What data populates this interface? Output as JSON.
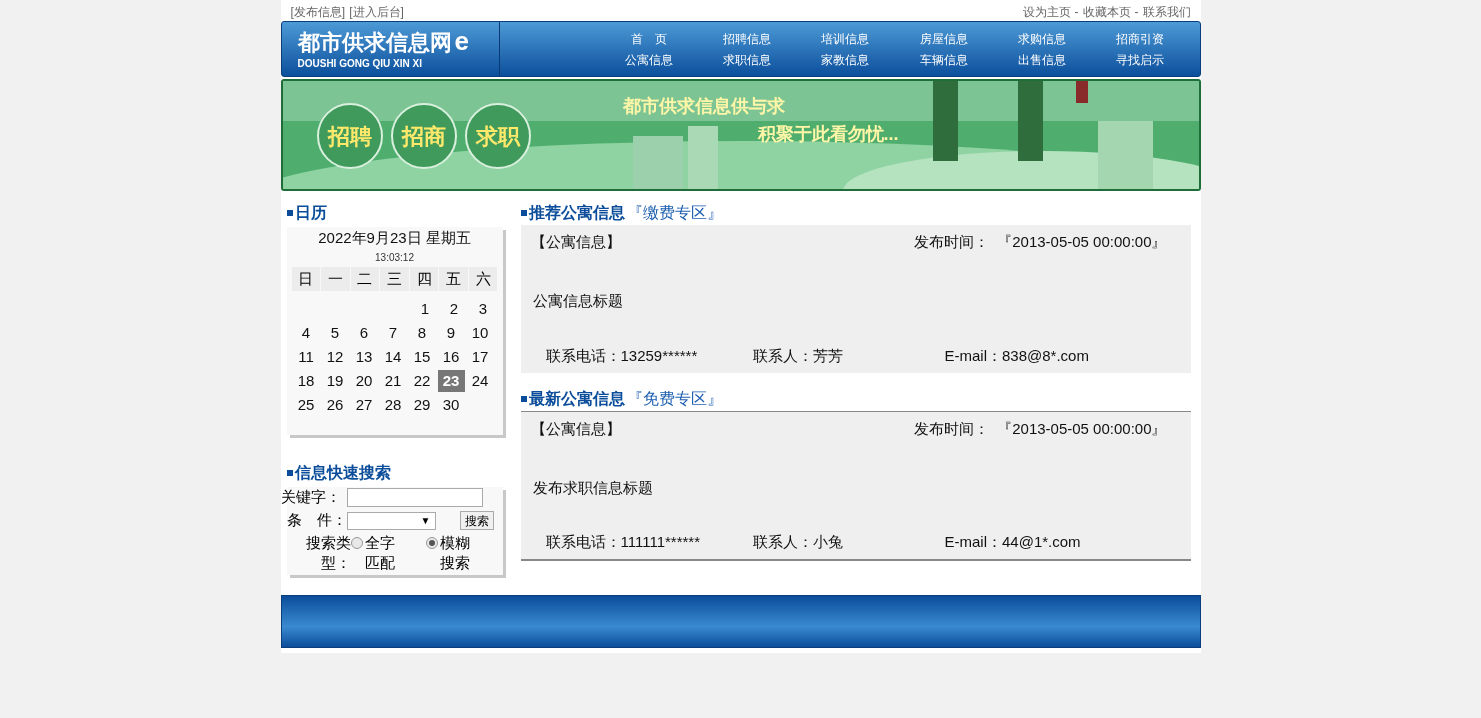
{
  "top_links_left": [
    "[发布信息]",
    "[进入后台]"
  ],
  "top_links_right": [
    "设为主页",
    "-",
    "收藏本页",
    "-",
    "联系我们"
  ],
  "logo": {
    "title": "都市供求信息网",
    "mark": "e",
    "subtitle": "DOUSHI GONG QIU XIN XI"
  },
  "nav": [
    [
      "首　页",
      "公寓信息"
    ],
    [
      "招聘信息",
      "求职信息"
    ],
    [
      "培训信息",
      "家教信息"
    ],
    [
      "房屋信息",
      "车辆信息"
    ],
    [
      "求购信息",
      "出售信息"
    ],
    [
      "招商引资",
      "寻找启示"
    ]
  ],
  "banner": {
    "buttons": [
      "招聘",
      "招商",
      "求职"
    ],
    "slogan_1": "都市供求信息供与求",
    "slogan_2": "积聚于此看勿忧..."
  },
  "calendar": {
    "heading": "日历",
    "date": "2022年9月23日 星期五",
    "time": "13:03:12",
    "weekdays": [
      "日",
      "一",
      "二",
      "三",
      "四",
      "五",
      "六"
    ],
    "weeks": [
      [
        {
          "day": "1",
          "selected": false
        },
        {
          "day": "2",
          "selected": false
        },
        {
          "day": "3",
          "selected": false
        }
      ],
      [
        {
          "day": "4",
          "selected": false
        },
        {
          "day": "5",
          "selected": false
        },
        {
          "day": "6",
          "selected": false
        },
        {
          "day": "7",
          "selected": false
        },
        {
          "day": "8",
          "selected": false
        },
        {
          "day": "9",
          "selected": false
        },
        {
          "day": "10",
          "selected": false
        }
      ],
      [
        {
          "day": "11",
          "selected": false
        },
        {
          "day": "12",
          "selected": false
        },
        {
          "day": "13",
          "selected": false
        },
        {
          "day": "14",
          "selected": false
        },
        {
          "day": "15",
          "selected": false
        },
        {
          "day": "16",
          "selected": false
        },
        {
          "day": "17",
          "selected": false
        }
      ],
      [
        {
          "day": "18",
          "selected": false
        },
        {
          "day": "19",
          "selected": false
        },
        {
          "day": "20",
          "selected": false
        },
        {
          "day": "21",
          "selected": false
        },
        {
          "day": "22",
          "selected": false
        },
        {
          "day": "23",
          "selected": true
        },
        {
          "day": "24",
          "selected": false
        }
      ],
      [
        {
          "day": "25",
          "selected": false
        },
        {
          "day": "26",
          "selected": false
        },
        {
          "day": "27",
          "selected": false
        },
        {
          "day": "28",
          "selected": false
        },
        {
          "day": "29",
          "selected": false
        },
        {
          "day": "30",
          "selected": false
        }
      ]
    ]
  },
  "search": {
    "heading": "信息快速搜索",
    "keyword_label": "关键字：",
    "condition_label": "条　件：",
    "dropdown_arrow": "▼",
    "button": "搜索",
    "type_label": "搜索类型：",
    "options": [
      {
        "label": "全字匹配",
        "selected": false
      },
      {
        "label": "模糊搜索",
        "selected": true
      }
    ]
  },
  "sections": [
    {
      "title": "推荐公寓信息",
      "tag": "『缴费专区』",
      "category": "【公寓信息】",
      "time_label": "发布时间：",
      "time": "『2013-05-05 00:00:00』",
      "headline": "公寓信息标题",
      "phone": "联系电话：13259******",
      "contact": "联系人：芳芳",
      "email": "E-mail：838@8*.com"
    },
    {
      "title": "最新公寓信息",
      "tag": "『免费专区』",
      "category": "【公寓信息】",
      "time_label": "发布时间：",
      "time": "『2013-05-05 00:00:00』",
      "headline": "发布求职信息标题",
      "phone": "联系电话：111111******",
      "contact": "联系人：小兔",
      "email": "E-mail：44@1*.com"
    }
  ]
}
